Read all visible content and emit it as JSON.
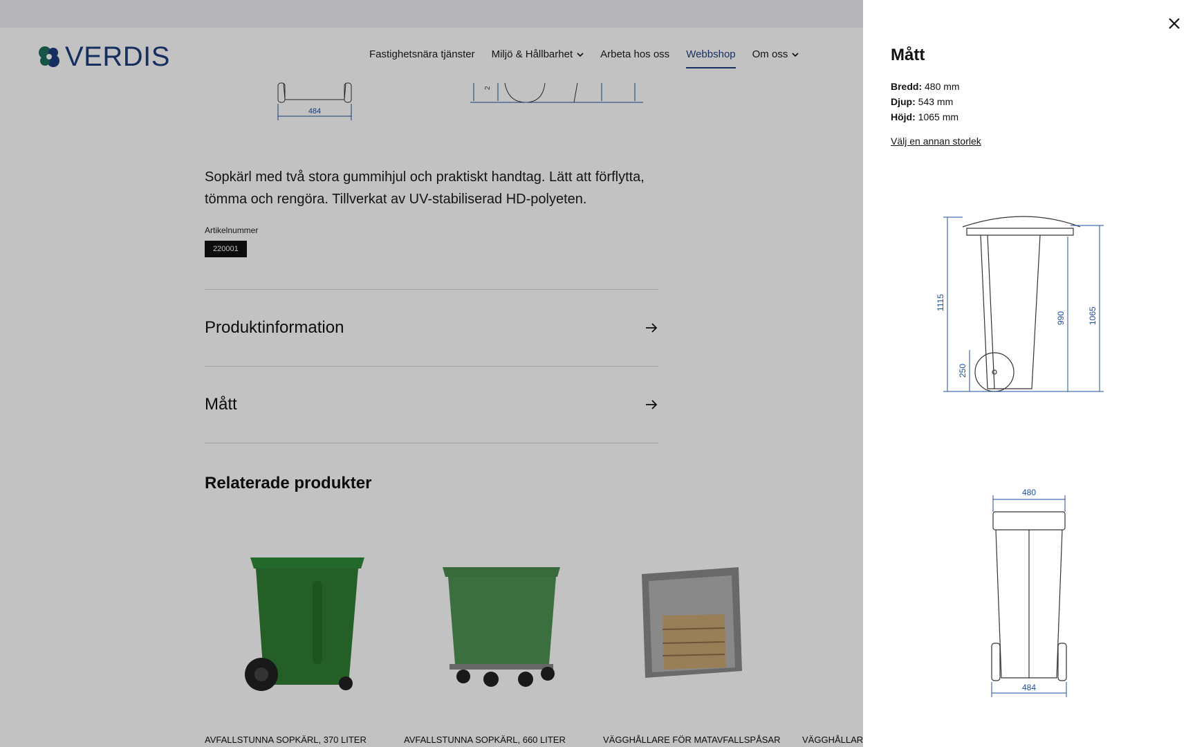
{
  "header": {
    "logo_text": "VERDIS",
    "nav": [
      {
        "label": "Fastighetsnära tjänster",
        "dropdown": false,
        "active": false
      },
      {
        "label": "Miljö & Hållbarhet",
        "dropdown": true,
        "active": false
      },
      {
        "label": "Arbeta hos oss",
        "dropdown": false,
        "active": false
      },
      {
        "label": "Webbshop",
        "dropdown": false,
        "active": true
      },
      {
        "label": "Om oss",
        "dropdown": true,
        "active": false
      }
    ]
  },
  "drawing_top": {
    "width_label": "484",
    "left_label": "2"
  },
  "product": {
    "description": "Sopkärl med två stora gummihjul och praktiskt handtag. Lätt att förflytta, tömma och rengöra. Tillverkat av UV-stabiliserad HD-polyeten.",
    "article_label": "Artikelnummer",
    "article_number": "220001",
    "sections": [
      "Produktinformation",
      "Mått"
    ]
  },
  "related": {
    "title": "Relaterade produkter",
    "items": [
      {
        "name": "AVFALLSTUNNA SOPKÄRL, 370 LITER"
      },
      {
        "name": "AVFALLSTUNNA SOPKÄRL, 660 LITER"
      },
      {
        "name": "VÄGGHÅLLARE FÖR MATAVFALLSPÅSAR"
      },
      {
        "name": "VÄGGHÅLLARE"
      }
    ]
  },
  "drawer": {
    "title": "Mått",
    "specs": [
      {
        "label": "Bredd:",
        "value": "480 mm"
      },
      {
        "label": "Djup:",
        "value": "543 mm"
      },
      {
        "label": "Höjd:",
        "value": "1065 mm"
      }
    ],
    "other_size_link": "Välj en annan storlek",
    "side_dims": {
      "d1115": "1115",
      "d250": "250",
      "d990": "990",
      "d1065": "1065"
    },
    "front_dims": {
      "top": "480",
      "bottom": "484"
    }
  },
  "colors": {
    "brand_blue": "#1e3f7d",
    "brand_teal": "#1f6f5c",
    "dim_blue": "#1e4d9b",
    "product_green": "#2e7d32"
  }
}
